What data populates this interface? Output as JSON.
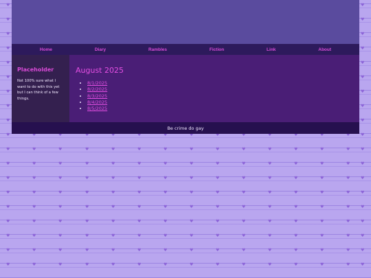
{
  "nav": {
    "items": [
      "Home",
      "Diary",
      "Rambles",
      "Fiction",
      "Link",
      "About"
    ]
  },
  "sidebar": {
    "title": "Placeholder",
    "text": "Not 100% sure what I want to do with this yet but I can think of a few things."
  },
  "main": {
    "title": "August 2025",
    "entries": [
      "8/1/2025",
      "8/2/2025",
      "8/3/2025",
      "8/4/2025",
      "8/5/2025"
    ]
  },
  "footer": {
    "text": "Be crime do gay"
  },
  "colors": {
    "background": "#b9a6ef",
    "banner": "#5a4b9e",
    "nav": "#2d1a5c",
    "sidebar": "#34204f",
    "main": "#4a1e76",
    "footer": "#26104f",
    "accent": "#e54fe3"
  },
  "icons": {
    "background_pattern": "heart-icon"
  }
}
